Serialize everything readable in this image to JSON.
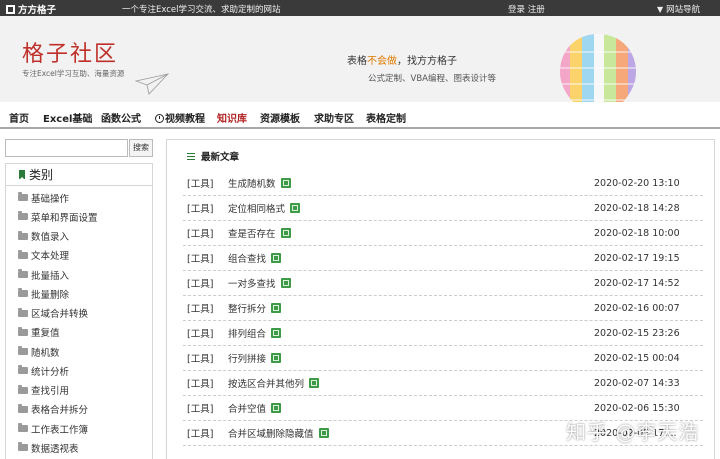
{
  "topbar": {
    "brand": "方方格子",
    "tagline": "一个专注Excel学习交流、求助定制的网站",
    "login": "登录 注册",
    "site_nav": "网站导航"
  },
  "header": {
    "site_title": "格子社区",
    "site_subtitle": "专注Excel学习互助、海量资源",
    "slogan_prefix": "表格",
    "slogan_highlight": "不会做",
    "slogan_suffix": "，找方方格子",
    "slogan_line2": "公式定制、VBA编程、图表设计等"
  },
  "nav": {
    "items": [
      "首页",
      "Excel基础",
      "函数公式",
      "视频教程",
      "知识库",
      "资源模板",
      "求助专区",
      "表格定制"
    ],
    "active": "知识库"
  },
  "search": {
    "button": "搜索",
    "value": ""
  },
  "sidebar": {
    "title": "类别",
    "categories": [
      "基础操作",
      "菜单和界面设置",
      "数值录入",
      "文本处理",
      "批量插入",
      "批量删除",
      "区域合并转换",
      "重复值",
      "随机数",
      "统计分析",
      "查找引用",
      "表格合并拆分",
      "工作表工作簿",
      "数据透视表"
    ]
  },
  "articles": {
    "heading": "最新文章",
    "rows": [
      {
        "tag": "[工具]",
        "title": "生成随机数",
        "date": "2020-02-20 13:10"
      },
      {
        "tag": "[工具]",
        "title": "定位相同格式",
        "date": "2020-02-18 14:28"
      },
      {
        "tag": "[工具]",
        "title": "查是否存在",
        "date": "2020-02-18 10:00"
      },
      {
        "tag": "[工具]",
        "title": "组合查找",
        "date": "2020-02-17 19:15"
      },
      {
        "tag": "[工具]",
        "title": "一对多查找",
        "date": "2020-02-17 14:52"
      },
      {
        "tag": "[工具]",
        "title": "整行拆分",
        "date": "2020-02-16 00:07"
      },
      {
        "tag": "[工具]",
        "title": "排列组合",
        "date": "2020-02-15 23:26"
      },
      {
        "tag": "[工具]",
        "title": "行列拼接",
        "date": "2020-02-15 00:04"
      },
      {
        "tag": "[工具]",
        "title": "按选区合并其他列",
        "date": "2020-02-07 14:33"
      },
      {
        "tag": "[工具]",
        "title": "合并空值",
        "date": "2020-02-06 15:30"
      },
      {
        "tag": "[工具]",
        "title": "合并区域删除隐藏值",
        "date": "2020-02-05 17:..."
      }
    ]
  },
  "watermark": "知乎 @李天浩",
  "colors": {
    "topbar": "#3a3a3a",
    "brand_red": "#c0302a",
    "active_nav": "#b22222",
    "accent_green": "#2a7a3a",
    "highlight_orange": "#e07a00"
  }
}
